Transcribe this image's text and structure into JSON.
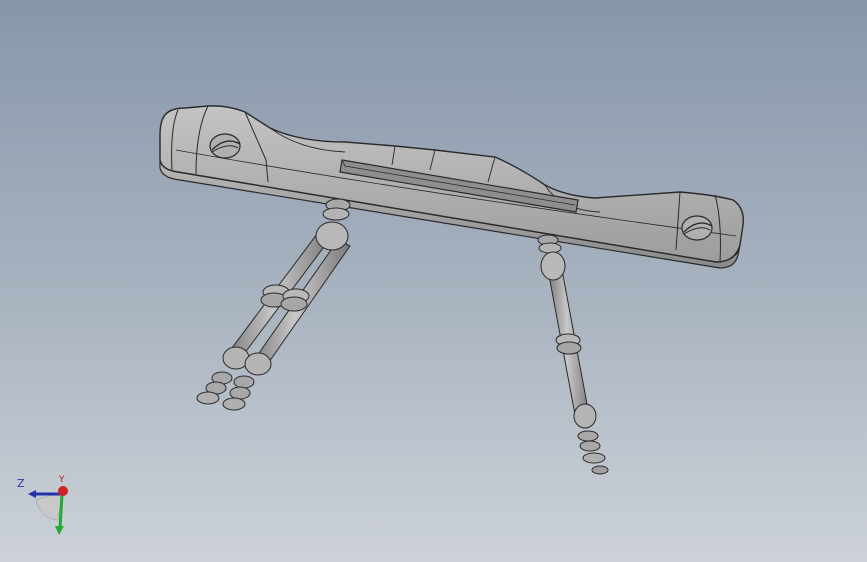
{
  "viewport": {
    "background_top": "#8797ab",
    "background_bottom": "#cdd2d8",
    "model_color": "#a2a2a2",
    "edge_color": "#2a2a2a"
  },
  "triad": {
    "z_label": "Z",
    "y_label": "Y",
    "x_color": "#cc2222",
    "y_color": "#22aa33",
    "z_color": "#2233aa"
  }
}
